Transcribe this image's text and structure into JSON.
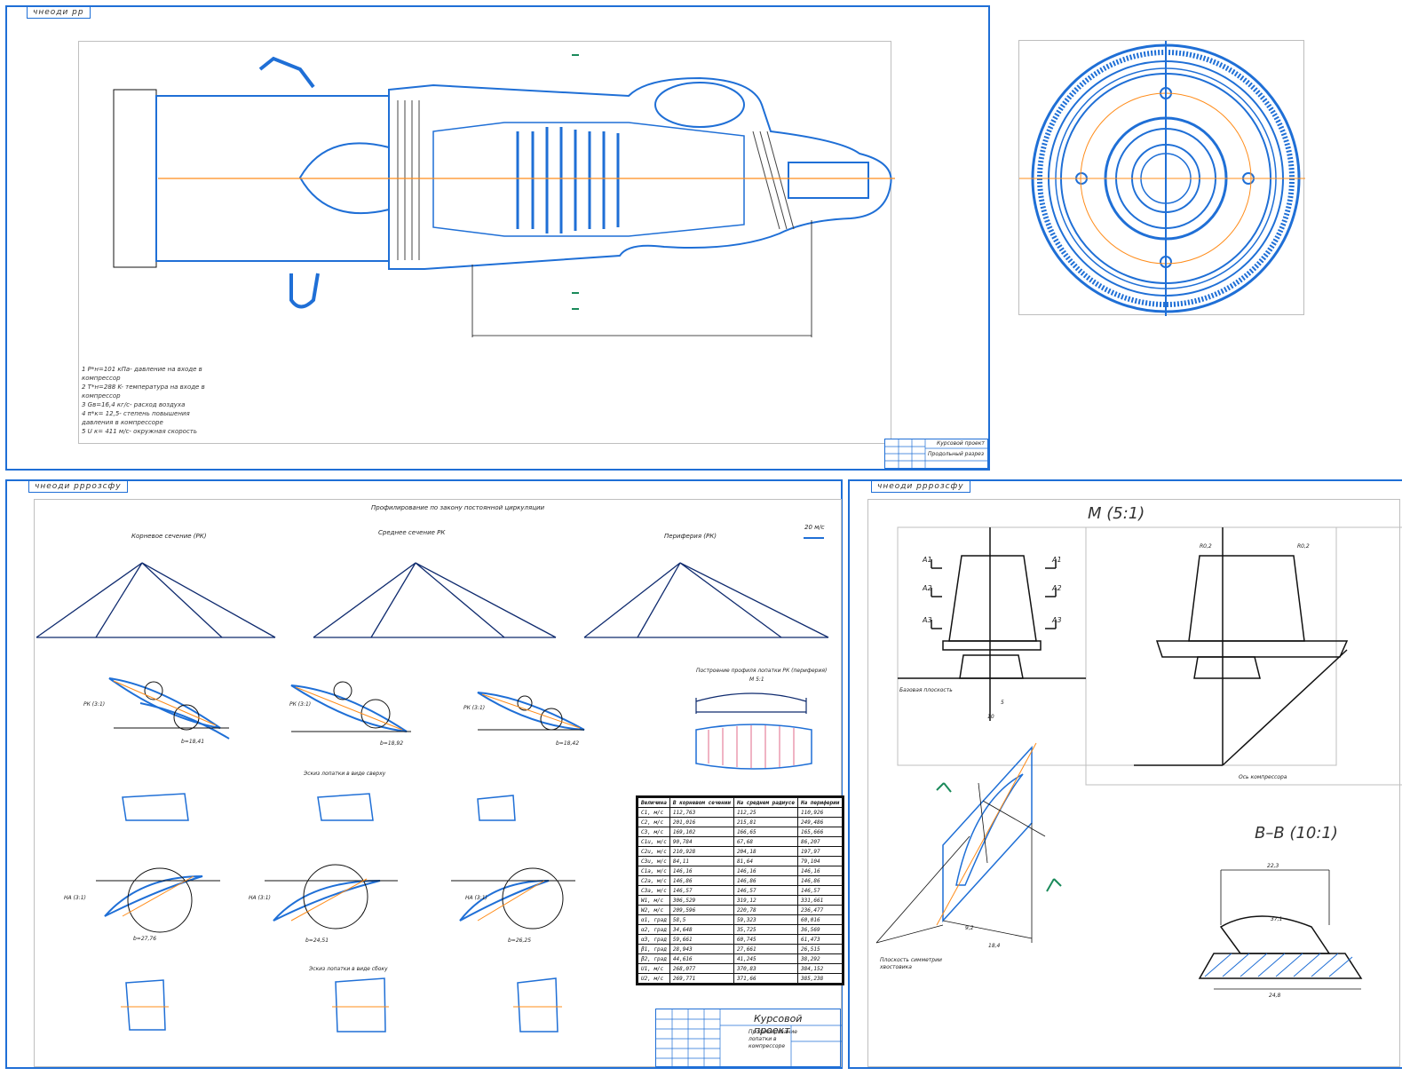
{
  "sheets": {
    "engine": {
      "tag": "чнеоди рр",
      "notes": [
        "1 P*н=101 кПа- давление на входе в компрессор",
        "2 T*н=288 K- температура на входе в компрессор",
        "3 Gв=16,4 кг/с- расход воздуха",
        "4 π*к= 12,5- степень повышения давления в компрессоре",
        "5 U к= 411 м/с- окружная скорость"
      ],
      "title_block": {
        "title": "Курсовой проект",
        "subtitle": "Продольный разрез"
      }
    },
    "blades": {
      "tag": "чнеоди рррозсфу",
      "main_title": "Профилирование по закону постоянной циркуляции",
      "triangle_titles": [
        "Корневое сечение (РК)",
        "Среднее сечение РК",
        "Периферия (РК)"
      ],
      "speed_scale": "20 м/с",
      "rk_labels": [
        "РК (3:1)",
        "РК (3:1)",
        "РК (3:1)"
      ],
      "na_labels": [
        "НА (3:1)",
        "НА (3:1)",
        "НА (3:1)"
      ],
      "rk_dims": [
        "b=18,41",
        "b=18,92",
        "b=18,42"
      ],
      "na_dims": [
        "b=27,76",
        "b=24,51",
        "b=26,25"
      ],
      "section1_title": "Эскиз лопатки в виде сверху",
      "section2_title": "Эскиз лопатки в виде сбоку",
      "profile_title": "Построение профиля лопатки РК (периферия)",
      "profile_scale": "М 5:1",
      "table": {
        "headers": [
          "Величина",
          "В корневом сечении",
          "На среднем радиусе",
          "На периферии"
        ],
        "rows": [
          [
            "C1, м/с",
            "112,763",
            "112,25",
            "110,926"
          ],
          [
            "C2, м/с",
            "201,016",
            "215,81",
            "249,486"
          ],
          [
            "C3, м/с",
            "169,102",
            "166,65",
            "165,666"
          ],
          [
            "C1u, м/с",
            "90,784",
            "67,68",
            "86,207"
          ],
          [
            "C2u, м/с",
            "210,928",
            "204,18",
            "197,97"
          ],
          [
            "C3u, м/с",
            "84,11",
            "81,64",
            "79,104"
          ],
          [
            "C1a, м/с",
            "146,16",
            "146,16",
            "146,16"
          ],
          [
            "C2a, м/с",
            "146,86",
            "146,86",
            "146,86"
          ],
          [
            "C3a, м/с",
            "146,57",
            "146,57",
            "146,57"
          ],
          [
            "W1, м/с",
            "306,529",
            "319,12",
            "331,661"
          ],
          [
            "W2, м/с",
            "209,596",
            "220,78",
            "236,477"
          ],
          [
            "α1, град",
            "58,5",
            "59,323",
            "60,016"
          ],
          [
            "α2, град",
            "34,648",
            "35,725",
            "36,569"
          ],
          [
            "α3, град",
            "59,661",
            "60,745",
            "61,473"
          ],
          [
            "β1, град",
            "28,943",
            "27,661",
            "26,515"
          ],
          [
            "β2, град",
            "44,616",
            "41,245",
            "38,292"
          ],
          [
            "U1, м/с",
            "268,077",
            "370,83",
            "384,152"
          ],
          [
            "U2, м/с",
            "269,771",
            "371,66",
            "385,238"
          ]
        ]
      },
      "title_block": {
        "title": "Курсовой проект",
        "subtitle": "Профилирование лопатки в компрессоре"
      }
    },
    "details": {
      "tag": "чнеоди рррозсфу",
      "view_m": "М (5:1)",
      "view_bb": "B–B (10:1)",
      "labels": {
        "a1": "A1",
        "a2": "A2",
        "a3": "A3",
        "base_plane": "Базовая плоскость",
        "axis": "Ось компрессора",
        "symmetry": "Плоскость симметрии хвостовика",
        "r02a": "R0,2",
        "r02b": "R0,2",
        "dim_10": "10",
        "dim_5": "5",
        "dim_92": "9,2",
        "dim_184": "18,4",
        "dim_223": "22,3",
        "dim_248": "24,8",
        "dim_371": "37,1"
      }
    },
    "disc": {}
  },
  "colors": {
    "line": "#1f6fd6",
    "axis": "#ff8c1a",
    "dark": "#0e2a6e",
    "hatch": "#444444",
    "pink": "#e06a8a"
  }
}
